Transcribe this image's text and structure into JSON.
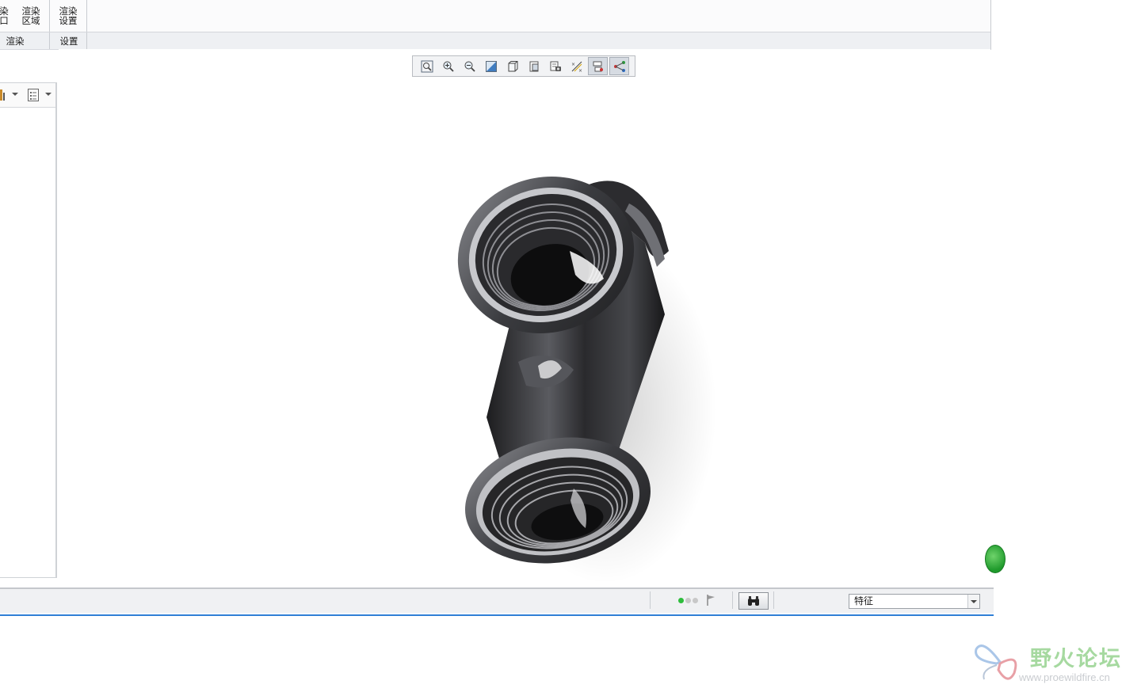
{
  "ribbon": {
    "buttons": [
      {
        "label": "染\n口"
      },
      {
        "label": "渲染\n区域"
      },
      {
        "label": "渲染\n设置"
      }
    ],
    "groups": [
      {
        "label": "渲染"
      },
      {
        "label": "设置"
      }
    ]
  },
  "graphics_toolbar": {
    "buttons": [
      {
        "icon": "refit-icon"
      },
      {
        "icon": "zoom-in-icon"
      },
      {
        "icon": "zoom-out-icon"
      },
      {
        "icon": "repaint-icon"
      },
      {
        "icon": "display-style-icon"
      },
      {
        "icon": "saved-orientation-icon"
      },
      {
        "icon": "view-manager-icon"
      },
      {
        "icon": "datum-display-icon"
      },
      {
        "icon": "spin-center-icon"
      },
      {
        "icon": "annotation-display-icon"
      }
    ]
  },
  "statusbar": {
    "filter_value": "特征"
  },
  "watermark": {
    "title": "野火论坛",
    "url": "www.proewildfire.cn"
  },
  "colors": {
    "accent_blue": "#2f7fd6",
    "status_green": "#2ebd3c",
    "watermark_green": "#a6d9a0"
  }
}
